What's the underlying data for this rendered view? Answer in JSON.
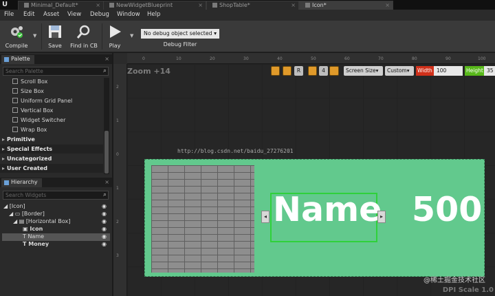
{
  "tabs": [
    {
      "label": "Minimal_Default*"
    },
    {
      "label": "NewWidgetBlueprint"
    },
    {
      "label": "ShopTable*"
    },
    {
      "label": "Icon*"
    }
  ],
  "menu": [
    "File",
    "Edit",
    "Asset",
    "View",
    "Debug",
    "Window",
    "Help"
  ],
  "toolbar": {
    "compile": "Compile",
    "save": "Save",
    "find": "Find in CB",
    "play": "Play",
    "debug_object": "No debug object selected",
    "debug_filter": "Debug Filter"
  },
  "palette": {
    "title": "Palette",
    "search_placeholder": "Search Palette",
    "items": [
      "Scroll Box",
      "Size Box",
      "Uniform Grid Panel",
      "Vertical Box",
      "Widget Switcher",
      "Wrap Box"
    ],
    "categories": [
      "Primitive",
      "Special Effects",
      "Uncategorized",
      "User Created"
    ]
  },
  "hierarchy": {
    "title": "Hierarchy",
    "search_placeholder": "Search Widgets",
    "items": [
      "[Icon]",
      "[Border]",
      "[Horizontal Box]",
      "Icon",
      "Name",
      "Money"
    ]
  },
  "viewport": {
    "zoom": "Zoom +14",
    "r_label": "R",
    "snap_value": "4",
    "screen_size": "Screen Size",
    "custom": "Custom",
    "width_label": "Width",
    "width_value": "100",
    "height_label": "Height",
    "height_value": "35",
    "dpi": "DPI Scale 1.0",
    "watermark": "http://blog.csdn.net/baidu_27276201",
    "credit": "@稀土掘金技术社区",
    "ruler_x": [
      "0",
      "10",
      "20",
      "30",
      "40",
      "50",
      "60",
      "70",
      "80",
      "90",
      "100"
    ],
    "ruler_y": [
      "2",
      "1",
      "0",
      "1",
      "2",
      "3"
    ]
  },
  "widget": {
    "name_text": "Name",
    "money_text": "500"
  },
  "colors": {
    "widget_bg": "#62c98d",
    "selection": "#2fd13a",
    "accent_orange": "#e09a2a"
  }
}
